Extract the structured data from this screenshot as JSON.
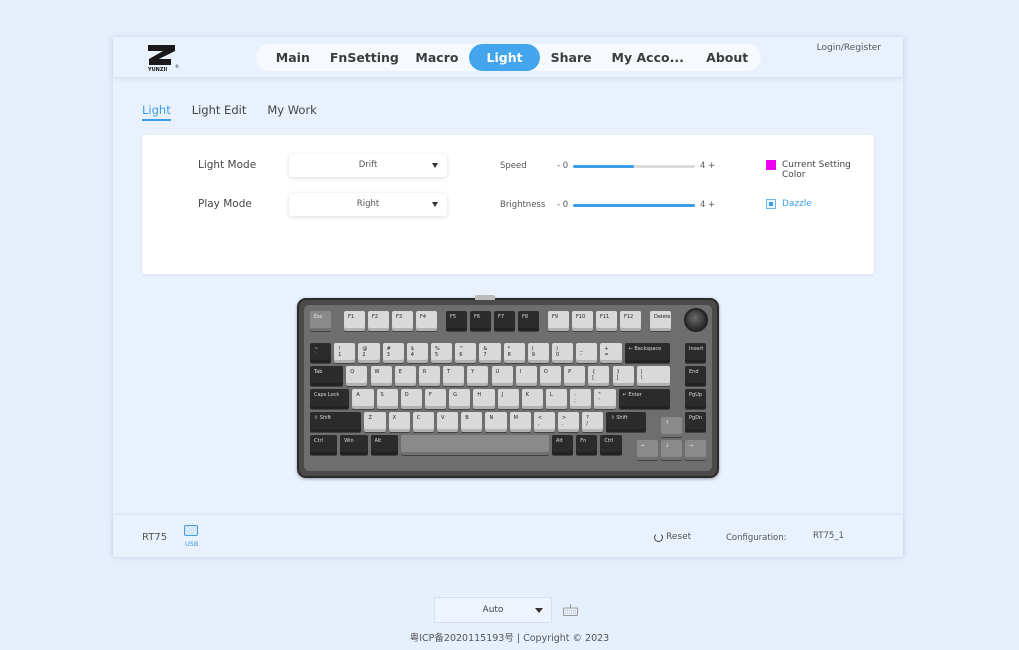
{
  "brand": {
    "logo_text": "YUNZII"
  },
  "nav": {
    "items": [
      {
        "label": "Main",
        "active": false
      },
      {
        "label": "FnSetting",
        "active": false
      },
      {
        "label": "Macro",
        "active": false
      },
      {
        "label": "Light",
        "active": true
      },
      {
        "label": "Share",
        "active": false
      },
      {
        "label": "My Acco...",
        "active": false
      },
      {
        "label": "About",
        "active": false
      }
    ],
    "login_label": "Login/Register"
  },
  "subtabs": [
    {
      "label": "Light",
      "active": true
    },
    {
      "label": "Light Edit",
      "active": false
    },
    {
      "label": "My Work",
      "active": false
    }
  ],
  "light_panel": {
    "light_mode": {
      "label": "Light Mode",
      "value": "Drift"
    },
    "play_mode": {
      "label": "Play Mode",
      "value": "Right"
    },
    "speed": {
      "label": "Speed",
      "minus": "- 0",
      "plus": "4 +",
      "value": 2,
      "max": 4
    },
    "brightness": {
      "label": "Brightness",
      "minus": "- 0",
      "plus": "4 +",
      "value": 4,
      "max": 4
    },
    "current_color": {
      "label": "Current Setting Color",
      "color": "#ee00ee"
    },
    "dazzle": {
      "label": "Dazzle",
      "checked": true
    }
  },
  "keyboard": {
    "rows": [
      [
        [
          "Esc",
          "m"
        ],
        [
          "F1",
          "l"
        ],
        [
          "F2",
          "l"
        ],
        [
          "F3",
          "l"
        ],
        [
          "F4",
          "l"
        ],
        [
          "F5",
          "d"
        ],
        [
          "F6",
          "d"
        ],
        [
          "F7",
          "d"
        ],
        [
          "F8",
          "d"
        ],
        [
          "F9",
          "l"
        ],
        [
          "F10",
          "l"
        ],
        [
          "F11",
          "l"
        ],
        [
          "F12",
          "l"
        ],
        [
          "Delete",
          "l"
        ]
      ],
      [
        [
          "~\n`",
          "d"
        ],
        [
          "!\n1",
          "l"
        ],
        [
          "@\n2",
          "l"
        ],
        [
          "#\n3",
          "l"
        ],
        [
          "$\n4",
          "l"
        ],
        [
          "%\n5",
          "l"
        ],
        [
          "^\n6",
          "l"
        ],
        [
          "&\n7",
          "l"
        ],
        [
          "*\n8",
          "l"
        ],
        [
          "(\n9",
          "l"
        ],
        [
          ")\n0",
          "l"
        ],
        [
          "_\n-",
          "l"
        ],
        [
          "+\n=",
          "l"
        ],
        [
          "← Backspace",
          "d"
        ],
        [
          "Insert",
          "d"
        ]
      ],
      [
        [
          "Tab",
          "d"
        ],
        [
          "Q",
          "l"
        ],
        [
          "W",
          "l"
        ],
        [
          "E",
          "l"
        ],
        [
          "R",
          "l"
        ],
        [
          "T",
          "l"
        ],
        [
          "Y",
          "l"
        ],
        [
          "U",
          "l"
        ],
        [
          "I",
          "l"
        ],
        [
          "O",
          "l"
        ],
        [
          "P",
          "l"
        ],
        [
          "{\n[",
          "l"
        ],
        [
          "}\n]",
          "l"
        ],
        [
          "|\n\\",
          "l"
        ],
        [
          "End",
          "d"
        ]
      ],
      [
        [
          "Caps Lock",
          "d"
        ],
        [
          "A",
          "l"
        ],
        [
          "S",
          "l"
        ],
        [
          "D",
          "l"
        ],
        [
          "F",
          "l"
        ],
        [
          "G",
          "l"
        ],
        [
          "H",
          "l"
        ],
        [
          "J",
          "l"
        ],
        [
          "K",
          "l"
        ],
        [
          "L",
          "l"
        ],
        [
          ":\n;",
          "l"
        ],
        [
          "\"\n'",
          "l"
        ],
        [
          "↵ Enter",
          "d"
        ],
        [
          "PgUp",
          "d"
        ]
      ],
      [
        [
          "⇧ Shift",
          "d"
        ],
        [
          "Z",
          "l"
        ],
        [
          "X",
          "l"
        ],
        [
          "C",
          "l"
        ],
        [
          "V",
          "l"
        ],
        [
          "B",
          "l"
        ],
        [
          "N",
          "l"
        ],
        [
          "M",
          "l"
        ],
        [
          "<\n,",
          "l"
        ],
        [
          ">\n.",
          "l"
        ],
        [
          "?\n/",
          "l"
        ],
        [
          "⇧ Shift",
          "d"
        ],
        [
          "↑",
          "m"
        ],
        [
          "PgDn",
          "d"
        ]
      ],
      [
        [
          "Ctrl",
          "d"
        ],
        [
          "Win",
          "d"
        ],
        [
          "Alt",
          "d"
        ],
        [
          "",
          "m"
        ],
        [
          "Alt",
          "d"
        ],
        [
          "Fn",
          "d"
        ],
        [
          "Ctrl",
          "d"
        ],
        [
          "←",
          "m"
        ],
        [
          "↓",
          "m"
        ],
        [
          "→",
          "m"
        ]
      ]
    ]
  },
  "footer": {
    "model": "RT75",
    "connection": "USB",
    "reset_label": "Reset",
    "config_label": "Configuration:",
    "config_value": "RT75_1"
  },
  "bottom": {
    "mode_select": "Auto",
    "copyright": "粤ICP备2020115193号 | Copyright © 2023"
  }
}
